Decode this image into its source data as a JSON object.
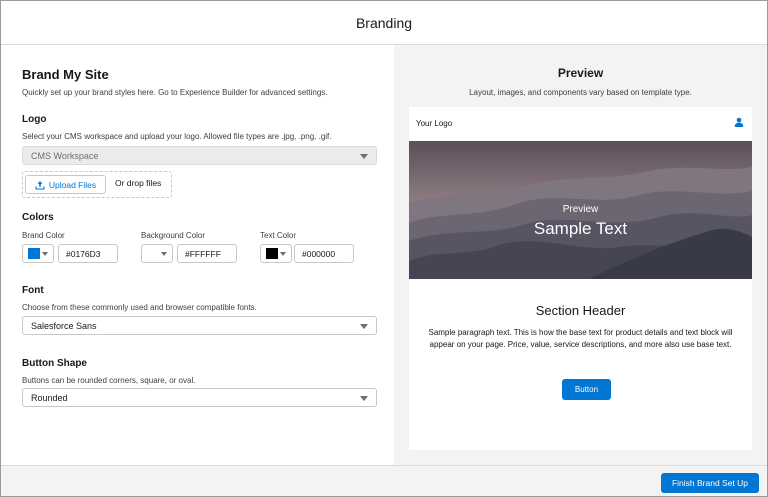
{
  "header": {
    "title": "Branding"
  },
  "left": {
    "title": "Brand My Site",
    "subtitle": "Quickly set up your brand styles here. Go to Experience Builder for advanced settings.",
    "logo": {
      "heading": "Logo",
      "help": "Select your CMS workspace and upload your logo. Allowed file types are .jpg, .png, .gif.",
      "workspace_value": "CMS Workspace",
      "upload_label": "Upload Files",
      "drop_label": "Or drop files"
    },
    "colors": {
      "heading": "Colors",
      "brand": {
        "label": "Brand Color",
        "value": "#0176D3",
        "swatch": "#0176D3"
      },
      "background": {
        "label": "Background Color",
        "value": "#FFFFFF",
        "swatch": "#FFFFFF"
      },
      "text": {
        "label": "Text Color",
        "value": "#000000",
        "swatch": "#000000"
      }
    },
    "font": {
      "heading": "Font",
      "help": "Choose from these commonly used and browser compatible fonts.",
      "value": "Salesforce Sans"
    },
    "button_shape": {
      "heading": "Button Shape",
      "help": "Buttons can be rounded corners, square, or oval.",
      "value": "Rounded"
    }
  },
  "preview": {
    "title": "Preview",
    "subtitle": "Layout, images, and components vary based on template type.",
    "logo_text": "Your Logo",
    "hero_label": "Preview",
    "hero_text": "Sample Text",
    "section_header": "Section Header",
    "paragraph": "Sample paragraph text. This is how the base text for product details and text block will appear on your page. Price, value, service descriptions, and more also use base text.",
    "button_label": "Button"
  },
  "footer": {
    "finish_label": "Finish Brand Set Up"
  },
  "colors": {
    "accent": "#0176D3",
    "panel": "#F3F3F3",
    "border": "#C9C7C5"
  },
  "icons": [
    "upload-icon",
    "user-icon",
    "chevron-down-icon"
  ]
}
